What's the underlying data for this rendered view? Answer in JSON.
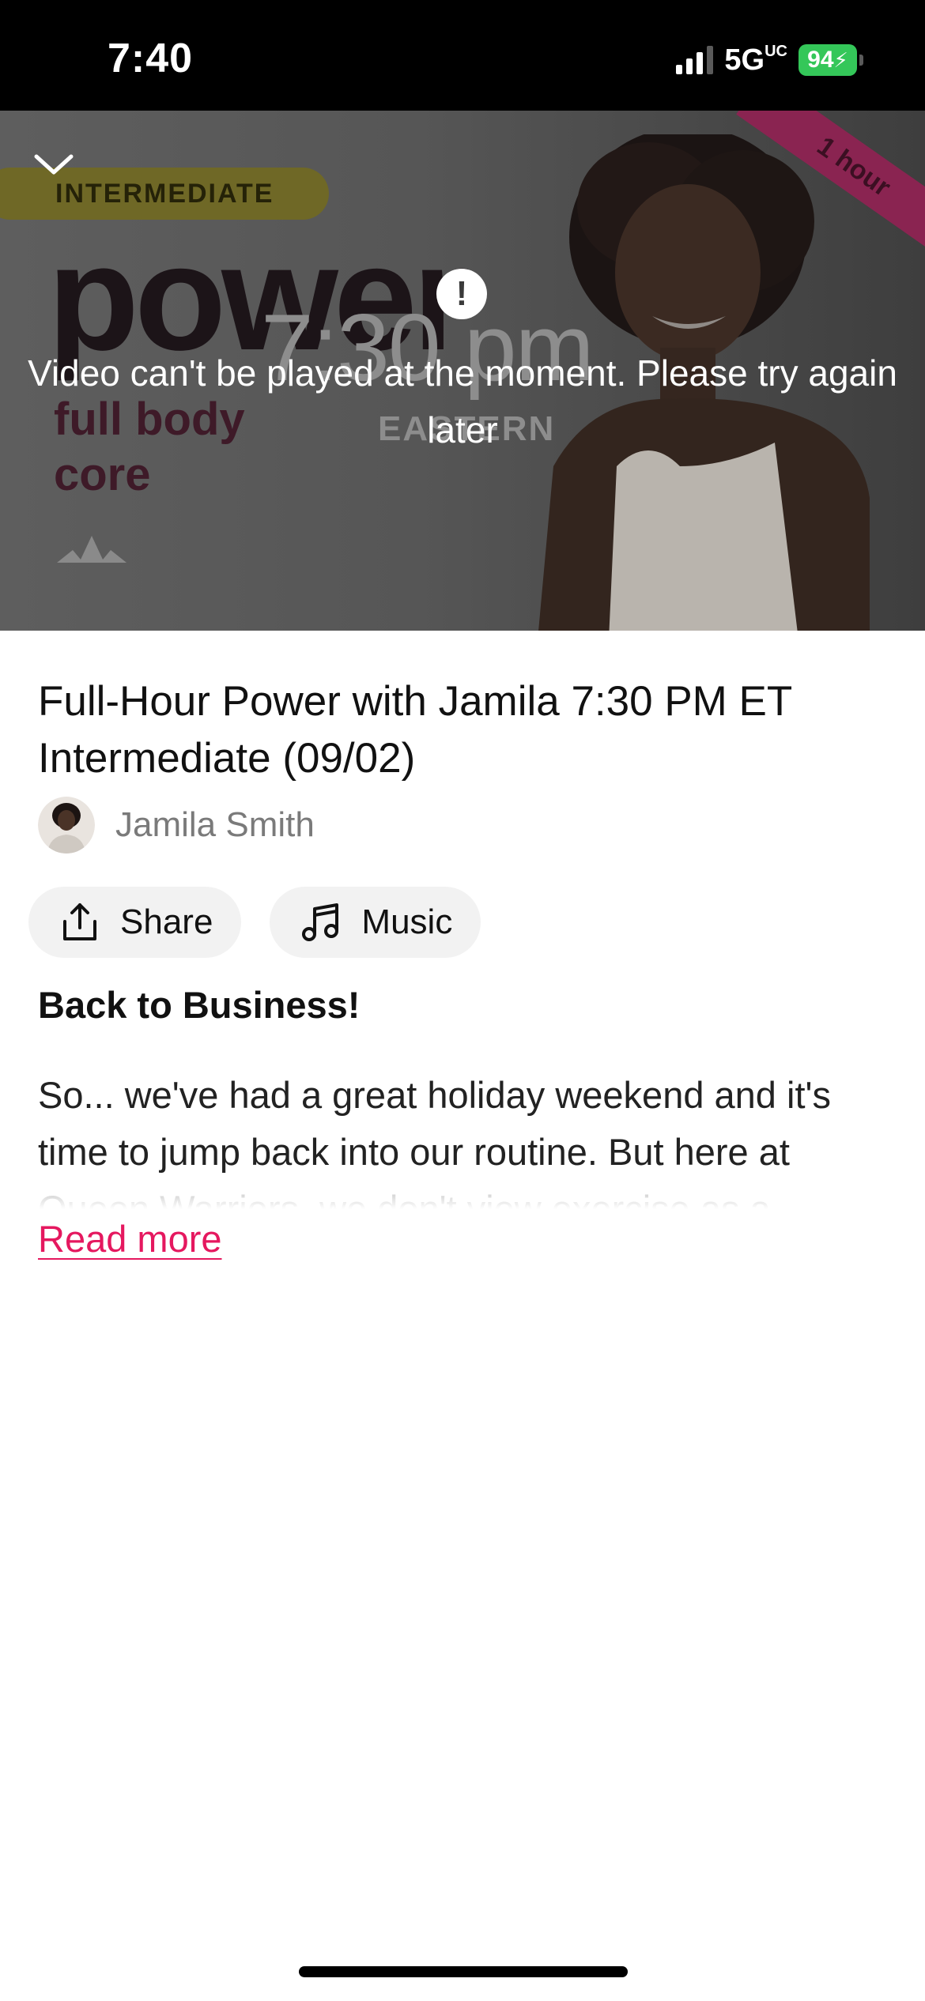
{
  "status_bar": {
    "time": "7:40",
    "network": "5G",
    "network_suffix": "UC",
    "battery": "94",
    "battery_color": "#34c759"
  },
  "video": {
    "level_badge": "INTERMEDIATE",
    "duration_ribbon": "1 hour",
    "brand_word": "power",
    "subtitle_line1": "full body",
    "subtitle_line2": "core",
    "start_time": "7:30 pm",
    "timezone": "EASTERN",
    "error_message": "Video can't be played at the moment. Please try again later",
    "collapse_icon": "chevron-down-icon",
    "alert_icon": "exclamation-icon"
  },
  "class": {
    "title": "Full-Hour Power with Jamila 7:30 PM ET Intermediate (09/02)",
    "instructor_name": "Jamila Smith"
  },
  "actions": {
    "share_label": "Share",
    "share_icon": "share-icon",
    "music_label": "Music",
    "music_icon": "music-note-icon"
  },
  "description": {
    "heading": "Back to Business!",
    "body": "So... we've had a great holiday weekend and it's time to jump back into our routine. But here at Queen Warriors, we don't view exercise as a",
    "read_more_label": "Read more",
    "link_color": "#e5185f"
  }
}
